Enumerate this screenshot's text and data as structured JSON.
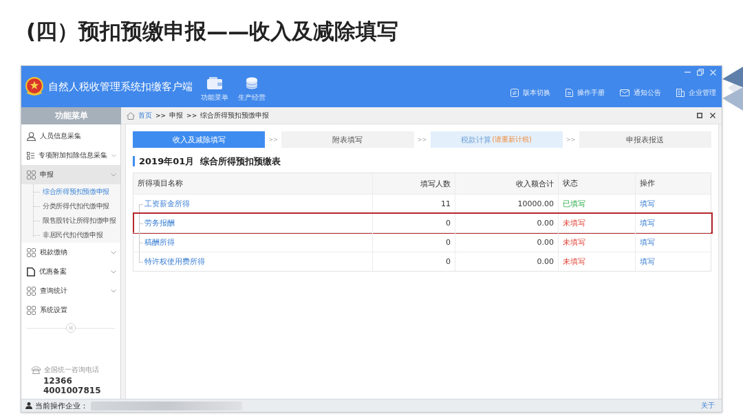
{
  "slide_title": "(四）预扣预缴申报——收入及减除填写",
  "app": {
    "title": "自然人税收管理系统扣缴客户端",
    "tools": [
      {
        "label": "功能菜单",
        "kind": "wallet"
      },
      {
        "label": "生产经营",
        "kind": "coins"
      }
    ],
    "links": [
      {
        "label": "版本切换",
        "kind": "switch"
      },
      {
        "label": "操作手册",
        "kind": "manual"
      },
      {
        "label": "通知公告",
        "kind": "mail"
      },
      {
        "label": "企业管理",
        "kind": "company"
      }
    ]
  },
  "sidebar": {
    "title": "功能菜单",
    "items": [
      {
        "label": "人员信息采集",
        "kind": "person"
      },
      {
        "label": "专项附加扣除信息采集",
        "kind": "list",
        "expanded": false
      },
      {
        "label": "申报",
        "kind": "grid",
        "expanded": true,
        "children": [
          {
            "label": "综合所得预扣预缴申报",
            "selected": true
          },
          {
            "label": "分类所得代扣代缴申报",
            "selected": false
          },
          {
            "label": "限售股转让所得扣缴申报",
            "selected": false
          },
          {
            "label": "非居民代扣代缴申报",
            "selected": false
          }
        ]
      },
      {
        "label": "税款缴纳",
        "kind": "grid",
        "expanded": false
      },
      {
        "label": "优惠备案",
        "kind": "document",
        "expanded": false
      },
      {
        "label": "查询统计",
        "kind": "grid",
        "expanded": false
      },
      {
        "label": "系统设置",
        "kind": "grid"
      }
    ],
    "hotline": {
      "label": "全国统一咨询电话",
      "numbers": [
        "12366",
        "4001007815"
      ]
    }
  },
  "breadcrumb": [
    {
      "label": "首页",
      "link": true
    },
    {
      "separator": ">>",
      "label": "申报",
      "link": false
    },
    {
      "separator": ">>",
      "label": "综合所得预扣预缴申报",
      "link": false
    }
  ],
  "steps": [
    {
      "label": "收入及减除填写",
      "selected": true,
      "flagged": false
    },
    {
      "arrow": ">>",
      "label": "附表填写",
      "selected": false,
      "flagged": false
    },
    {
      "arrow": ">>",
      "label": "税款计算",
      "note": "(请重新计税)",
      "selected": false,
      "flagged": true
    },
    {
      "arrow": ">>",
      "label": "申报表报送",
      "selected": false,
      "flagged": false
    }
  ],
  "form_title": "2019年01月  综合所得预扣预缴表",
  "table": {
    "columns": [
      {
        "label": "所得项目名称",
        "kind": "name"
      },
      {
        "label": "填写人数",
        "kind": "count"
      },
      {
        "label": "收入额合计",
        "kind": "amount"
      },
      {
        "label": "状态",
        "kind": "status"
      },
      {
        "label": "操作",
        "kind": "action"
      }
    ],
    "rows": [
      {
        "name": "工资薪金所得",
        "count": "11",
        "amount": "10000.00",
        "status": "已填写",
        "filled": true,
        "action": "填写",
        "highlighted": false
      },
      {
        "name": "劳务报酬",
        "count": "0",
        "amount": "0.00",
        "status": "未填写",
        "filled": false,
        "action": "填写",
        "highlighted": true
      },
      {
        "name": "稿酬所得",
        "count": "0",
        "amount": "0.00",
        "status": "未填写",
        "filled": false,
        "action": "填写",
        "highlighted": false
      },
      {
        "name": "特许权使用费所得",
        "count": "0",
        "amount": "0.00",
        "status": "未填写",
        "filled": false,
        "action": "填写",
        "highlighted": false
      }
    ]
  },
  "status_bar": {
    "label": "当前操作企业：",
    "about": "关于"
  }
}
